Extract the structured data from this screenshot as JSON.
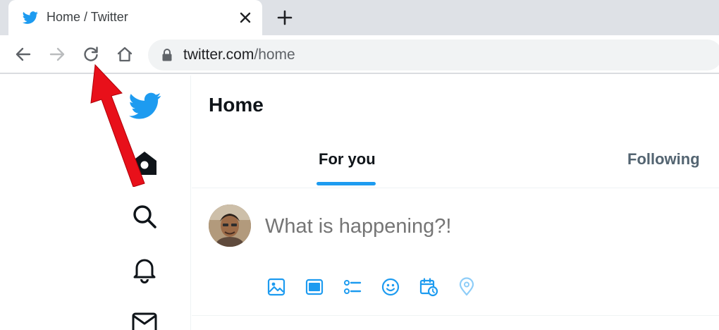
{
  "browser": {
    "tab": {
      "title": "Home / Twitter"
    },
    "url": {
      "domain": "twitter.com",
      "path": "/home"
    }
  },
  "timeline": {
    "title": "Home",
    "tabs": [
      {
        "label": "For you",
        "active": true
      },
      {
        "label": "Following",
        "active": false
      }
    ]
  },
  "composer": {
    "placeholder": "What is happening?!",
    "tools": [
      "image-icon",
      "gif-icon",
      "poll-icon",
      "emoji-icon",
      "schedule-icon",
      "location-icon"
    ]
  },
  "colors": {
    "accent": "#1d9bf0",
    "annotation_arrow": "#e8101a"
  }
}
